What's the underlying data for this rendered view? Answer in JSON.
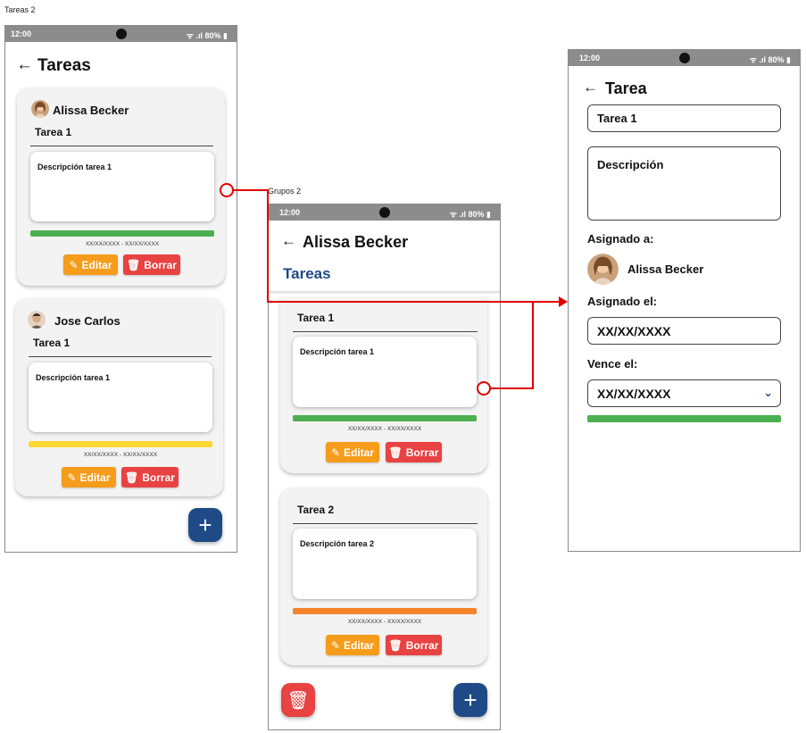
{
  "frames": {
    "left_label": "Tareas 2",
    "middle_label": "Grupos 2"
  },
  "status": {
    "time": "12:00",
    "battery": "80%",
    "signal": "ᯤ .ıl"
  },
  "screen1": {
    "back": "←",
    "title": "Tareas",
    "cards": [
      {
        "user": "Alissa Becker",
        "task": "Tarea 1",
        "description": "Descripción tarea 1",
        "dates": "XX/XX/XXXX - XX/XX/XXXX",
        "bar_color": "#4caf50"
      },
      {
        "user": "Jose Carlos",
        "task": "Tarea 1",
        "description": "Descripción tarea 1",
        "dates": "XX/XX/XXXX - XX/XX/XXXX",
        "bar_color": "#fdd835"
      }
    ],
    "edit_label": "Editar",
    "delete_label": "Borrar",
    "fab": "+"
  },
  "screen2": {
    "back": "←",
    "title": "Alissa Becker",
    "subtitle": "Tareas",
    "cards": [
      {
        "task": "Tarea 1",
        "description": "Descripción tarea 1",
        "dates": "XX/XX/XXXX - XX/XX/XXXX",
        "bar_color": "#4caf50"
      },
      {
        "task": "Tarea 2",
        "description": "Descripción tarea 2",
        "dates": "XX/XX/XXXX - XX/XX/XXXX",
        "bar_color": "#f4842b"
      }
    ],
    "edit_label": "Editar",
    "delete_label": "Borrar",
    "fab": "+"
  },
  "screen3": {
    "back": "←",
    "title": "Tarea",
    "task_value": "Tarea 1",
    "description_placeholder": "Descripción",
    "assigned_to_label": "Asignado a:",
    "assigned_user": "Alissa Becker",
    "assigned_on_label": "Asignado el:",
    "assigned_on_value": "XX/XX/XXXX",
    "due_label": "Vence el:",
    "due_value": "XX/XX/XXXX",
    "bar_color": "#4caf50"
  },
  "colors": {
    "primary": "#1e4a86",
    "edit": "#f59c1a",
    "delete": "#e84242",
    "connector": "#e00000"
  }
}
